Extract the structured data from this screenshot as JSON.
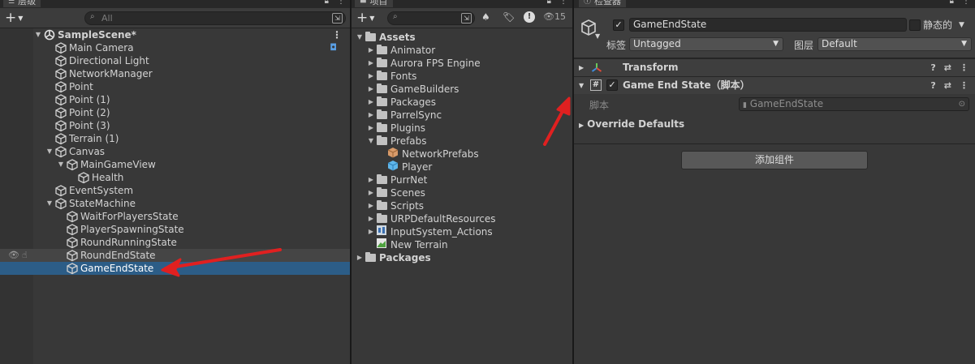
{
  "hierarchy": {
    "tab_label": "层级",
    "search_placeholder": "All",
    "scene_name": "SampleScene*",
    "items": [
      {
        "label": "Main Camera",
        "depth": 1,
        "expand": ""
      },
      {
        "label": "Directional Light",
        "depth": 1,
        "expand": ""
      },
      {
        "label": "NetworkManager",
        "depth": 1,
        "expand": ""
      },
      {
        "label": "Point",
        "depth": 1,
        "expand": ""
      },
      {
        "label": "Point (1)",
        "depth": 1,
        "expand": ""
      },
      {
        "label": "Point (2)",
        "depth": 1,
        "expand": ""
      },
      {
        "label": "Point (3)",
        "depth": 1,
        "expand": ""
      },
      {
        "label": "Terrain (1)",
        "depth": 1,
        "expand": ""
      },
      {
        "label": "Canvas",
        "depth": 1,
        "expand": "▼"
      },
      {
        "label": "MainGameView",
        "depth": 2,
        "expand": "▼"
      },
      {
        "label": "Health",
        "depth": 3,
        "expand": ""
      },
      {
        "label": "EventSystem",
        "depth": 1,
        "expand": ""
      },
      {
        "label": "StateMachine",
        "depth": 1,
        "expand": "▼"
      },
      {
        "label": "WaitForPlayersState",
        "depth": 2,
        "expand": ""
      },
      {
        "label": "PlayerSpawningState",
        "depth": 2,
        "expand": ""
      },
      {
        "label": "RoundRunningState",
        "depth": 2,
        "expand": ""
      },
      {
        "label": "RoundEndState",
        "depth": 2,
        "expand": ""
      },
      {
        "label": "GameEndState",
        "depth": 2,
        "expand": ""
      }
    ]
  },
  "project": {
    "tab_label": "项目",
    "hidden_count": "15",
    "tree": [
      {
        "label": "Assets",
        "depth": 0,
        "expand": "▼",
        "icon": "folder-open-icon"
      },
      {
        "label": "Animator",
        "depth": 1,
        "expand": "▶",
        "icon": "folder-icon"
      },
      {
        "label": "Aurora FPS Engine",
        "depth": 1,
        "expand": "▶",
        "icon": "folder-icon"
      },
      {
        "label": "Fonts",
        "depth": 1,
        "expand": "▶",
        "icon": "folder-icon"
      },
      {
        "label": "GameBuilders",
        "depth": 1,
        "expand": "▶",
        "icon": "folder-icon"
      },
      {
        "label": "Packages",
        "depth": 1,
        "expand": "▶",
        "icon": "folder-icon"
      },
      {
        "label": "ParrelSync",
        "depth": 1,
        "expand": "▶",
        "icon": "folder-icon"
      },
      {
        "label": "Plugins",
        "depth": 1,
        "expand": "▶",
        "icon": "folder-icon"
      },
      {
        "label": "Prefabs",
        "depth": 1,
        "expand": "▼",
        "icon": "folder-open-icon"
      },
      {
        "label": "NetworkPrefabs",
        "depth": 2,
        "expand": "",
        "icon": "prefab-variant-icon"
      },
      {
        "label": "Player",
        "depth": 2,
        "expand": "",
        "icon": "prefab-icon"
      },
      {
        "label": "PurrNet",
        "depth": 1,
        "expand": "▶",
        "icon": "folder-icon"
      },
      {
        "label": "Scenes",
        "depth": 1,
        "expand": "▶",
        "icon": "folder-icon"
      },
      {
        "label": "Scripts",
        "depth": 1,
        "expand": "▶",
        "icon": "folder-icon"
      },
      {
        "label": "URPDefaultResources",
        "depth": 1,
        "expand": "▶",
        "icon": "folder-icon"
      },
      {
        "label": "InputSystem_Actions",
        "depth": 1,
        "expand": "▶",
        "icon": "input-actions-icon"
      },
      {
        "label": "New Terrain",
        "depth": 1,
        "expand": "",
        "icon": "terrain-icon"
      },
      {
        "label": "Packages",
        "depth": 0,
        "expand": "▶",
        "icon": "folder-icon"
      }
    ]
  },
  "inspector": {
    "tab_label": "检查器",
    "object_name": "GameEndState",
    "static_label": "静态的",
    "tag_label": "标签",
    "tag_value": "Untagged",
    "layer_label": "图层",
    "layer_value": "Default",
    "transform_label": "Transform",
    "script_component_label": "Game End State（脚本）",
    "script_field_label": "脚本",
    "script_field_value": "GameEndState",
    "override_label": "Override Defaults",
    "add_component_label": "添加组件"
  }
}
